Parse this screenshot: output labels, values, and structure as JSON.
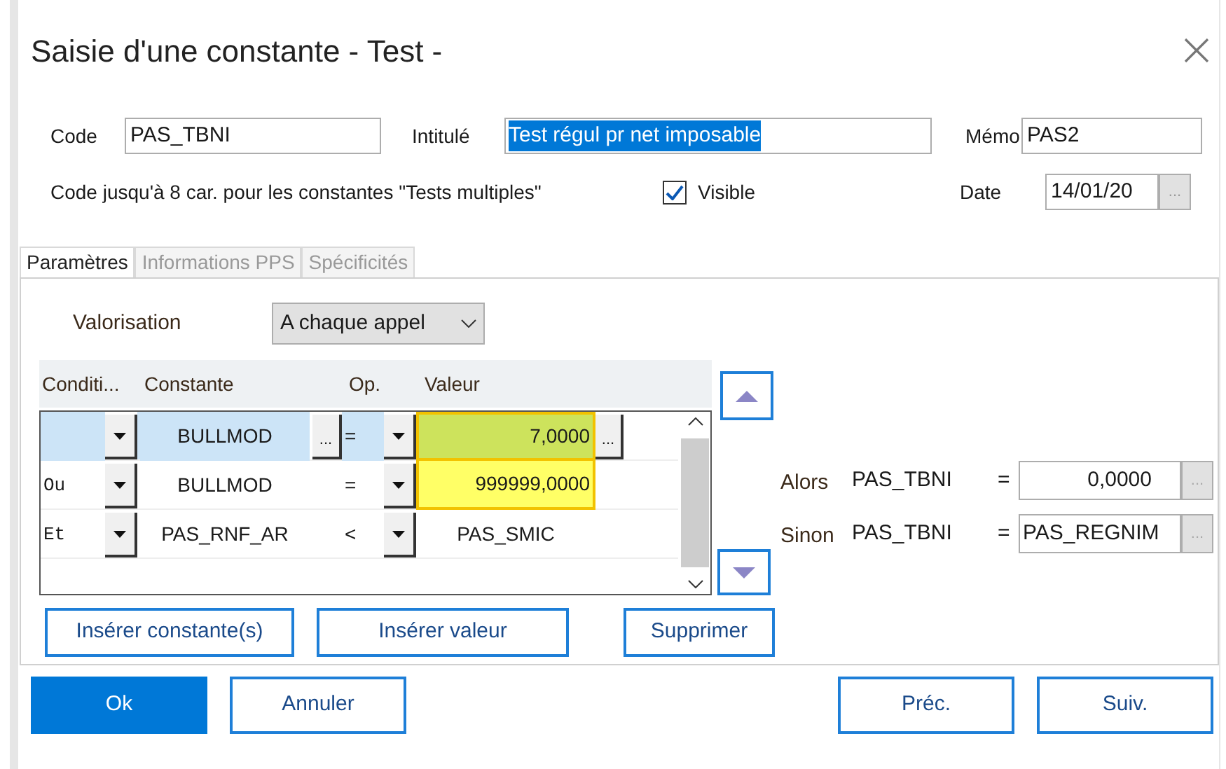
{
  "window": {
    "title": "Saisie d'une constante - Test -"
  },
  "code": {
    "label": "Code",
    "value": "PAS_TBNI"
  },
  "intitule": {
    "label": "Intitulé",
    "value": "Test régul pr net imposable",
    "selected": true
  },
  "memo": {
    "label": "Mémo",
    "value": "PAS2"
  },
  "hint": "Code jusqu'à 8 car. pour les constantes \"Tests multiples\"",
  "visible": {
    "label": "Visible",
    "checked": true
  },
  "date": {
    "label": "Date",
    "value": "14/01/20",
    "button": "..."
  },
  "tabs": [
    {
      "label": "Paramètres",
      "selected": true
    },
    {
      "label": "Informations PPS",
      "selected": false
    },
    {
      "label": "Spécificités",
      "selected": false
    }
  ],
  "valorisation": {
    "label": "Valorisation",
    "value": "A chaque appel"
  },
  "grid": {
    "columns": [
      "Conditi...",
      "Constante",
      "Op.",
      "Valeur"
    ],
    "ellipsis": "...",
    "rows": [
      {
        "constante": "BULLMOD",
        "op": "=",
        "valeur": "7,0000",
        "selected": true,
        "highlighted": true
      },
      {
        "condition": "Ou",
        "constante": "BULLMOD",
        "op": "=",
        "valeur": "999999,0000",
        "selected": false,
        "highlighted": true
      },
      {
        "condition": "Et",
        "constante": "PAS_RNF_AR",
        "op": "<",
        "valeur": "PAS_SMIC",
        "selected": false,
        "highlighted": false
      }
    ]
  },
  "results": [
    {
      "label": "Alors",
      "constant": "PAS_TBNI",
      "op": "=",
      "value": "0,0000",
      "kind": "number",
      "button": "..."
    },
    {
      "label": "Sinon",
      "constant": "PAS_TBNI",
      "op": "=",
      "value": "PAS_REGNIM",
      "kind": "text",
      "button": "..."
    }
  ],
  "grid_buttons": [
    "Insérer constante(s)",
    "Insérer valeur",
    "Supprimer"
  ],
  "footer": {
    "left": [
      {
        "label": "Ok",
        "primary": true
      },
      {
        "label": "Annuler",
        "primary": false
      }
    ],
    "right": [
      {
        "label": "Préc.",
        "primary": false
      },
      {
        "label": "Suiv.",
        "primary": false
      }
    ]
  }
}
